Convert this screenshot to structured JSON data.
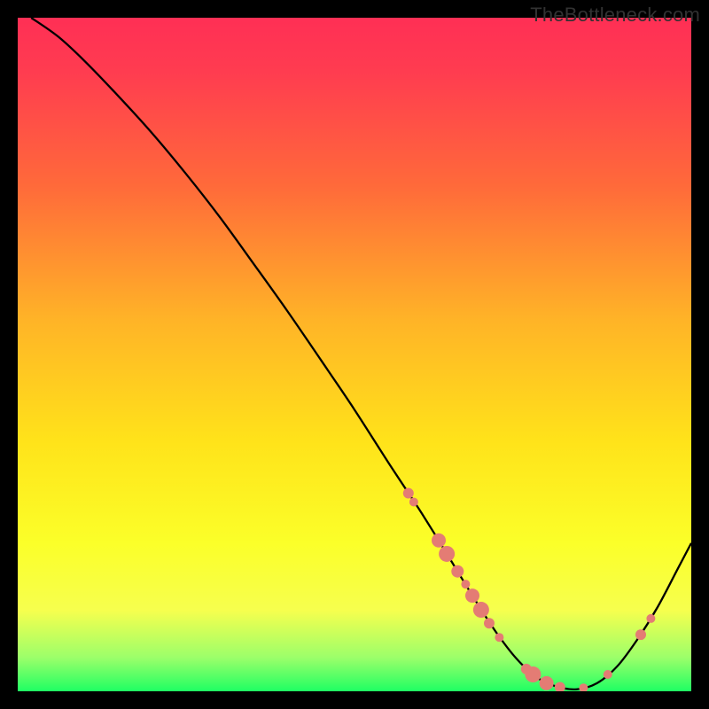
{
  "watermark": "TheBottleneck.com",
  "chart_data": {
    "type": "line",
    "title": "",
    "xlabel": "",
    "ylabel": "",
    "xlim": [
      0,
      100
    ],
    "ylim": [
      0,
      100
    ],
    "note": "Heat background from red (high bottleneck) at top to green (optimal) at bottom; curve shows bottleneck amount vs. configuration; salmon dots mark sampled configurations near the optimum.",
    "series": [
      {
        "name": "bottleneck-curve",
        "color": "#000000",
        "x": [
          2,
          6,
          10,
          15,
          20,
          25,
          30,
          35,
          40,
          45,
          50,
          55,
          58.5,
          60,
          62,
          65,
          68,
          71,
          74,
          77,
          80,
          83,
          86,
          89,
          92,
          95,
          98,
          100
        ],
        "y": [
          100,
          97.2,
          93.5,
          88.3,
          82.8,
          76.8,
          70.4,
          63.5,
          56.5,
          49.2,
          41.8,
          34,
          28.7,
          26.4,
          23.2,
          18.3,
          13.4,
          8.8,
          4.9,
          2.1,
          0.7,
          0.3,
          1.2,
          3.7,
          7.7,
          12.5,
          18.2,
          22
        ]
      }
    ],
    "points": [
      {
        "name": "sample",
        "x": 58.0,
        "y": 29.4,
        "r": 6
      },
      {
        "name": "sample",
        "x": 58.8,
        "y": 28.1,
        "r": 5
      },
      {
        "name": "sample",
        "x": 62.5,
        "y": 22.4,
        "r": 8
      },
      {
        "name": "sample",
        "x": 63.7,
        "y": 20.4,
        "r": 9
      },
      {
        "name": "sample",
        "x": 65.3,
        "y": 17.8,
        "r": 7
      },
      {
        "name": "sample",
        "x": 66.5,
        "y": 15.9,
        "r": 5
      },
      {
        "name": "sample",
        "x": 67.5,
        "y": 14.2,
        "r": 8
      },
      {
        "name": "sample",
        "x": 68.8,
        "y": 12.1,
        "r": 9
      },
      {
        "name": "sample",
        "x": 70.0,
        "y": 10.1,
        "r": 6
      },
      {
        "name": "sample",
        "x": 71.5,
        "y": 8.0,
        "r": 5
      },
      {
        "name": "sample",
        "x": 75.5,
        "y": 3.3,
        "r": 6
      },
      {
        "name": "sample",
        "x": 76.5,
        "y": 2.5,
        "r": 9
      },
      {
        "name": "sample",
        "x": 78.5,
        "y": 1.2,
        "r": 8
      },
      {
        "name": "sample",
        "x": 80.5,
        "y": 0.6,
        "r": 6
      },
      {
        "name": "sample",
        "x": 84.0,
        "y": 0.5,
        "r": 5
      },
      {
        "name": "sample",
        "x": 87.6,
        "y": 2.5,
        "r": 5
      },
      {
        "name": "sample",
        "x": 92.5,
        "y": 8.4,
        "r": 6
      },
      {
        "name": "sample",
        "x": 94.0,
        "y": 10.8,
        "r": 5
      }
    ],
    "point_color": "#e47c74"
  }
}
